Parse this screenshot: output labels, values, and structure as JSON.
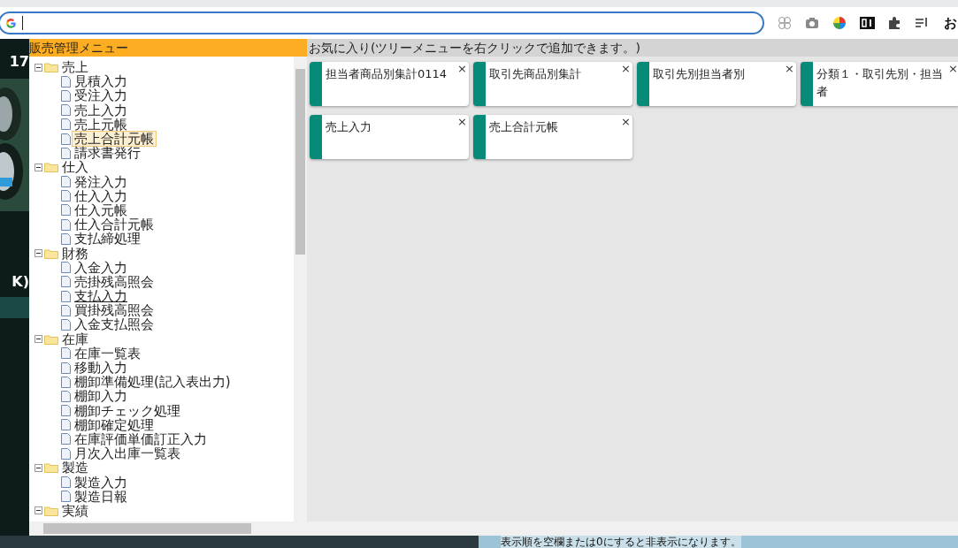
{
  "browser": {
    "partial_text": "お"
  },
  "left_strip": {
    "texts": [
      "17",
      "K)"
    ]
  },
  "menu": {
    "title": "販売管理メニュー",
    "tree": [
      {
        "label": "売上",
        "expanded": true,
        "children": [
          {
            "label": "見積入力",
            "selected": false
          },
          {
            "label": "受注入力",
            "selected": false
          },
          {
            "label": "売上入力",
            "selected": false
          },
          {
            "label": "売上元帳",
            "selected": false
          },
          {
            "label": "売上合計元帳",
            "selected": true
          },
          {
            "label": "請求書発行",
            "selected": false
          }
        ]
      },
      {
        "label": "仕入",
        "expanded": true,
        "children": [
          {
            "label": "発注入力",
            "selected": false
          },
          {
            "label": "仕入入力",
            "selected": false
          },
          {
            "label": "仕入元帳",
            "selected": false
          },
          {
            "label": "仕入合計元帳",
            "selected": false
          },
          {
            "label": "支払締処理",
            "selected": false
          }
        ]
      },
      {
        "label": "財務",
        "expanded": true,
        "children": [
          {
            "label": "入金入力",
            "selected": false
          },
          {
            "label": "売掛残高照会",
            "selected": false
          },
          {
            "label": "支払入力",
            "selected": false,
            "hovered": true
          },
          {
            "label": "買掛残高照会",
            "selected": false
          },
          {
            "label": "入金支払照会",
            "selected": false
          }
        ]
      },
      {
        "label": "在庫",
        "expanded": true,
        "children": [
          {
            "label": "在庫一覧表",
            "selected": false
          },
          {
            "label": "移動入力",
            "selected": false
          },
          {
            "label": "棚卸準備処理(記入表出力)",
            "selected": false
          },
          {
            "label": "棚卸入力",
            "selected": false
          },
          {
            "label": "棚卸チェック処理",
            "selected": false
          },
          {
            "label": "棚卸確定処理",
            "selected": false
          },
          {
            "label": "在庫評価単価訂正入力",
            "selected": false
          },
          {
            "label": "月次入出庫一覧表",
            "selected": false
          }
        ]
      },
      {
        "label": "製造",
        "expanded": true,
        "children": [
          {
            "label": "製造入力",
            "selected": false
          },
          {
            "label": "製造日報",
            "selected": false
          }
        ]
      },
      {
        "label": "実績",
        "expanded": true
      }
    ]
  },
  "favorites": {
    "title": "お気に入り(ツリーメニューを右クリックで追加できます。)",
    "items": [
      {
        "label": "担当者商品別集計0114",
        "close": "×"
      },
      {
        "label": "取引先商品別集計",
        "close": "×"
      },
      {
        "label": "取引先別担当者別",
        "close": "×"
      },
      {
        "label": "分類１・取引先別・担当者",
        "close": "×"
      },
      {
        "label": "売上入力",
        "close": "×"
      },
      {
        "label": "売上合計元帳",
        "close": "×"
      }
    ]
  },
  "bottom_text": "表示順を空欄または0にすると非表示になります。"
}
